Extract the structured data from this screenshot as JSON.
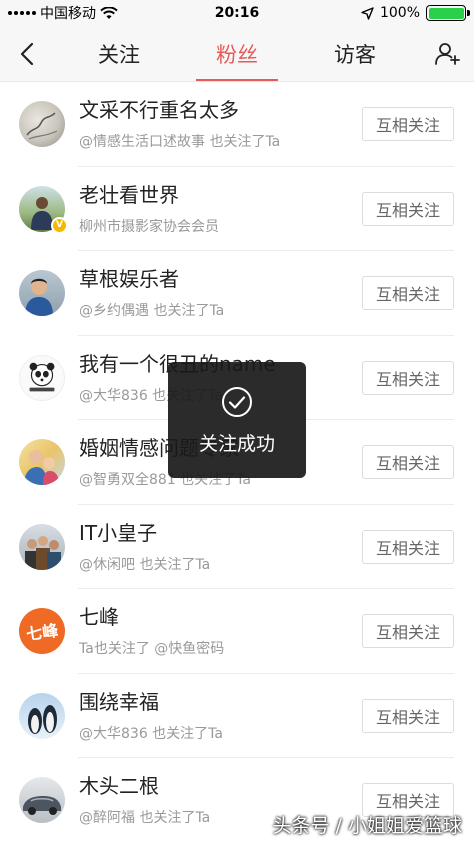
{
  "status_bar": {
    "carrier": "中国移动",
    "time": "20:16",
    "battery": "100%",
    "battery_level": 1.0
  },
  "nav": {
    "tabs": [
      {
        "label": "关注",
        "active": false
      },
      {
        "label": "粉丝",
        "active": true
      },
      {
        "label": "访客",
        "active": false
      }
    ],
    "accent_color": "#e85a5a"
  },
  "followers": [
    {
      "name": "文采不行重名太多",
      "sub": "@情感生活口述故事 也关注了Ta",
      "button": "互相关注",
      "avatar": "sketch",
      "verified": false
    },
    {
      "name": "老壮看世界",
      "sub": "柳州市摄影家协会会员",
      "button": "互相关注",
      "avatar": "person-outdoor",
      "verified": true
    },
    {
      "name": "草根娱乐者",
      "sub": "@乡约偶遇 也关注了Ta",
      "button": "互相关注",
      "avatar": "kid",
      "verified": false
    },
    {
      "name": "我有一个很丑的name",
      "sub": "@大华836 也关注了Ta",
      "button": "互相关注",
      "avatar": "panda",
      "verified": false
    },
    {
      "name": "婚姻情感问题专家",
      "sub": "@智勇双全881 也关注了Ta",
      "button": "互相关注",
      "avatar": "family",
      "verified": false
    },
    {
      "name": "IT小皇子",
      "sub": "@休闲吧 也关注了Ta",
      "button": "互相关注",
      "avatar": "group",
      "verified": false
    },
    {
      "name": "七峰",
      "sub": "Ta也关注了 @快鱼密码",
      "button": "互相关注",
      "avatar": "logo-orange",
      "verified": false,
      "avatar_text": "七峰"
    },
    {
      "name": "围绕幸福",
      "sub": "@大华836 也关注了Ta",
      "button": "互相关注",
      "avatar": "penguins",
      "verified": false
    },
    {
      "name": "木头二根",
      "sub": "@醉阿福 也关注了Ta",
      "button": "互相关注",
      "avatar": "car",
      "verified": false
    }
  ],
  "toast": {
    "text": "关注成功",
    "icon": "check-circle-icon"
  },
  "watermark": "头条号 / 小姐姐爱篮球"
}
